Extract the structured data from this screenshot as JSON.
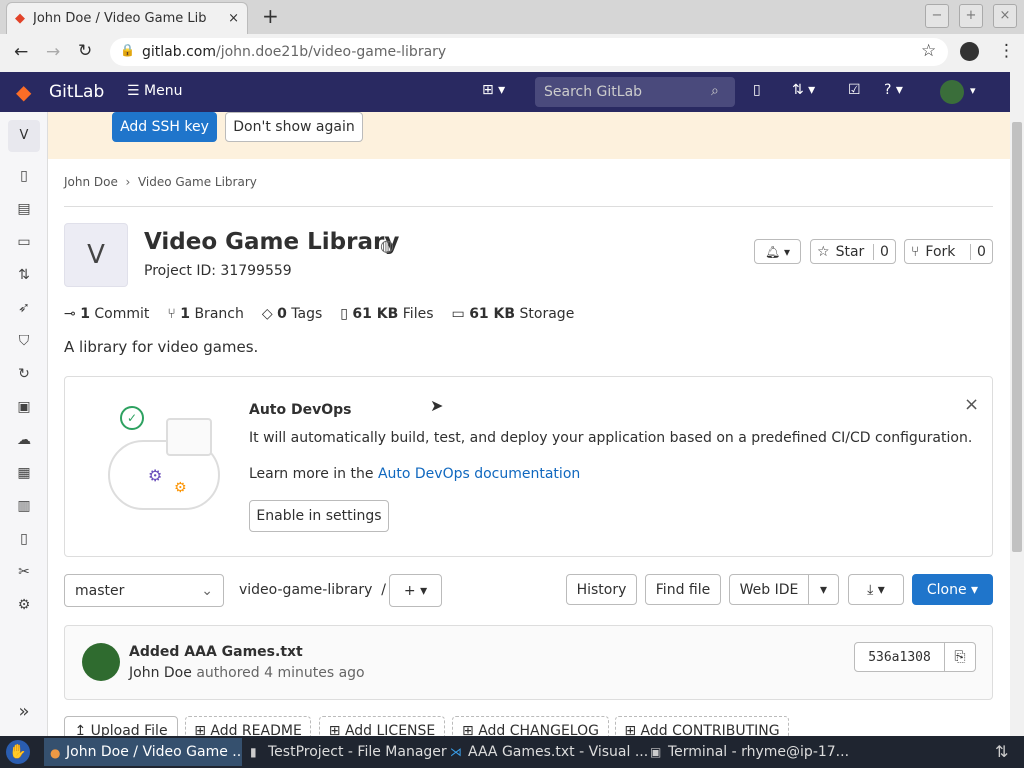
{
  "browser": {
    "tab_title": "John Doe / Video Game Lib",
    "url_host": "gitlab.com",
    "url_path": "/john.doe21b/video-game-library",
    "win_min": "−",
    "win_max": "+",
    "win_close": "×"
  },
  "gitlab": {
    "logo": "GitLab",
    "menu": "Menu",
    "search_placeholder": "Search GitLab"
  },
  "banner": {
    "add_ssh": "Add SSH key",
    "dont_show": "Don't show again"
  },
  "breadcrumb": [
    "John Doe",
    "Video Game Library"
  ],
  "project": {
    "avatar": "V",
    "title": "Video Game Library",
    "id": "Project ID: 31799559",
    "star": "Star",
    "star_count": "0",
    "fork": "Fork",
    "fork_count": "0",
    "description": "A library for video games."
  },
  "stats": [
    {
      "n": "1",
      "l": "Commit"
    },
    {
      "n": "1",
      "l": "Branch"
    },
    {
      "n": "0",
      "l": "Tags"
    },
    {
      "n": "61 KB",
      "l": "Files"
    },
    {
      "n": "61 KB",
      "l": "Storage"
    }
  ],
  "devops": {
    "title": "Auto DevOps",
    "text": "It will automatically build, test, and deploy your application based on a predefined CI/CD configuration.",
    "learn": "Learn more in the",
    "link": "Auto DevOps documentation",
    "button": "Enable in settings"
  },
  "repo": {
    "branch": "master",
    "path": "video-game-library",
    "sep": "/",
    "history": "History",
    "find": "Find file",
    "webide": "Web IDE",
    "clone": "Clone"
  },
  "commit": {
    "message": "Added AAA Games.txt",
    "author": "John Doe",
    "meta": "authored 4 minutes ago",
    "sha": "536a1308"
  },
  "actions": [
    "Upload File",
    "Add README",
    "Add LICENSE",
    "Add CHANGELOG",
    "Add CONTRIBUTING"
  ],
  "taskbar": [
    "John Doe / Video Game ...",
    "TestProject - File Manager",
    "AAA Games.txt - Visual ...",
    "Terminal - rhyme@ip-17..."
  ]
}
